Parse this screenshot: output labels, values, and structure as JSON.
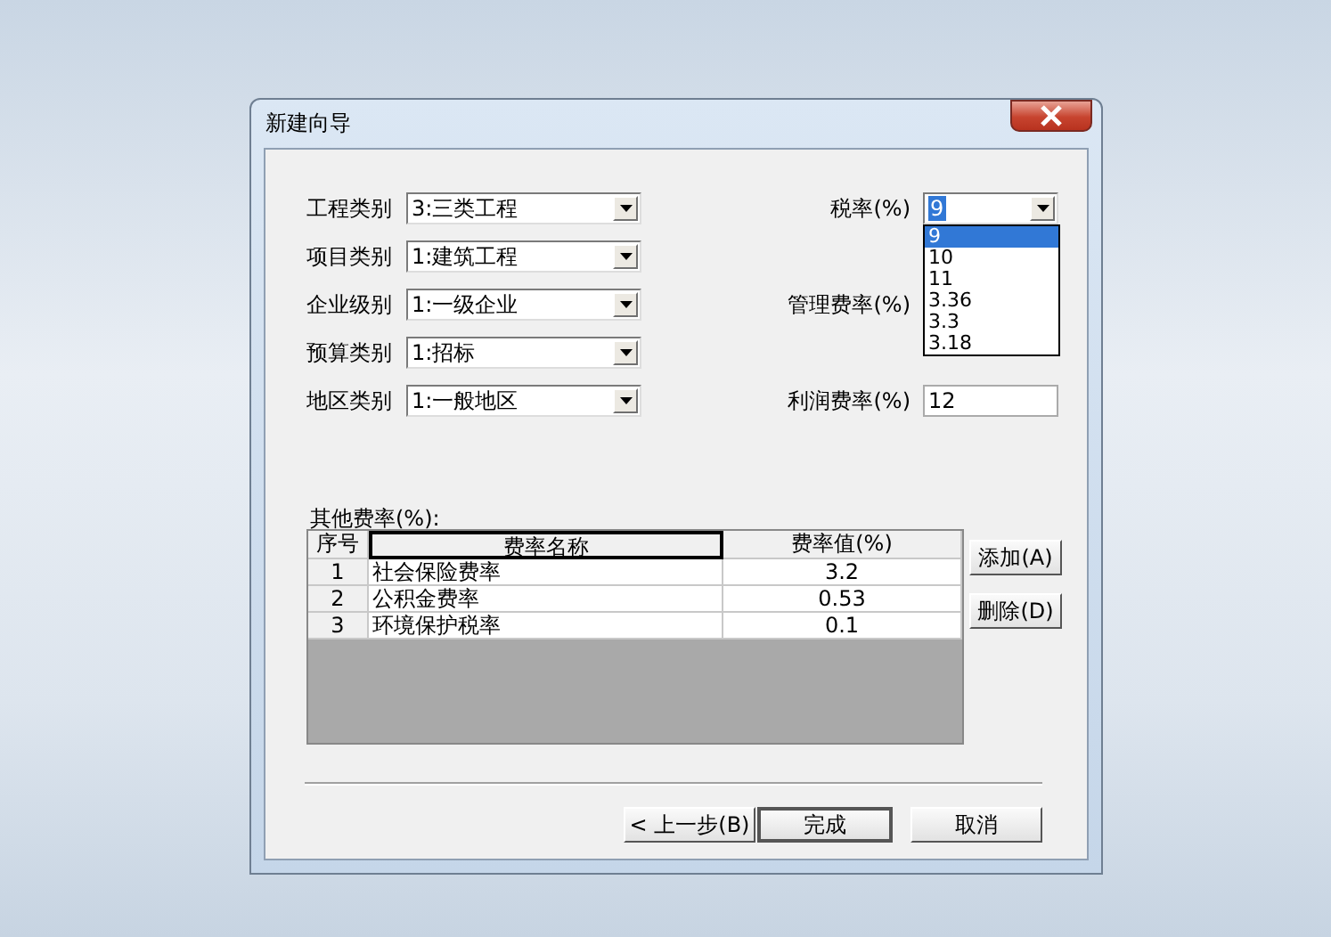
{
  "window": {
    "title": "新建向导"
  },
  "left_fields": [
    {
      "label": "工程类别",
      "value": "3:三类工程"
    },
    {
      "label": "项目类别",
      "value": "1:建筑工程"
    },
    {
      "label": "企业级别",
      "value": "1:一级企业"
    },
    {
      "label": "预算类别",
      "value": "1:招标"
    },
    {
      "label": "地区类别",
      "value": "1:一般地区"
    }
  ],
  "right_fields": [
    {
      "kind": "combo",
      "label": "税率(%)",
      "value": "9",
      "options": [
        {
          "label": "9",
          "selected": true
        },
        {
          "label": "10",
          "selected": false
        },
        {
          "label": "11",
          "selected": false
        },
        {
          "label": "3.36",
          "selected": false
        },
        {
          "label": "3.3",
          "selected": false
        },
        {
          "label": "3.18",
          "selected": false
        }
      ]
    },
    {
      "kind": "covered",
      "label": "管理费率(%)"
    },
    {
      "kind": "text",
      "label": "利润费率(%)",
      "value": "12"
    }
  ],
  "other_rates": {
    "label": "其他费率(%):",
    "columns": [
      "序号",
      "费率名称",
      "费率值(%)"
    ],
    "rows": [
      [
        "1",
        "社会保险费率",
        "3.2"
      ],
      [
        "2",
        "公积金费率",
        "0.53"
      ],
      [
        "3",
        "环境保护税率",
        "0.1"
      ]
    ],
    "buttons": [
      "添加(A)",
      "删除(D)"
    ]
  },
  "footer_buttons": [
    "< 上一步(B)",
    "完成",
    "取消"
  ]
}
